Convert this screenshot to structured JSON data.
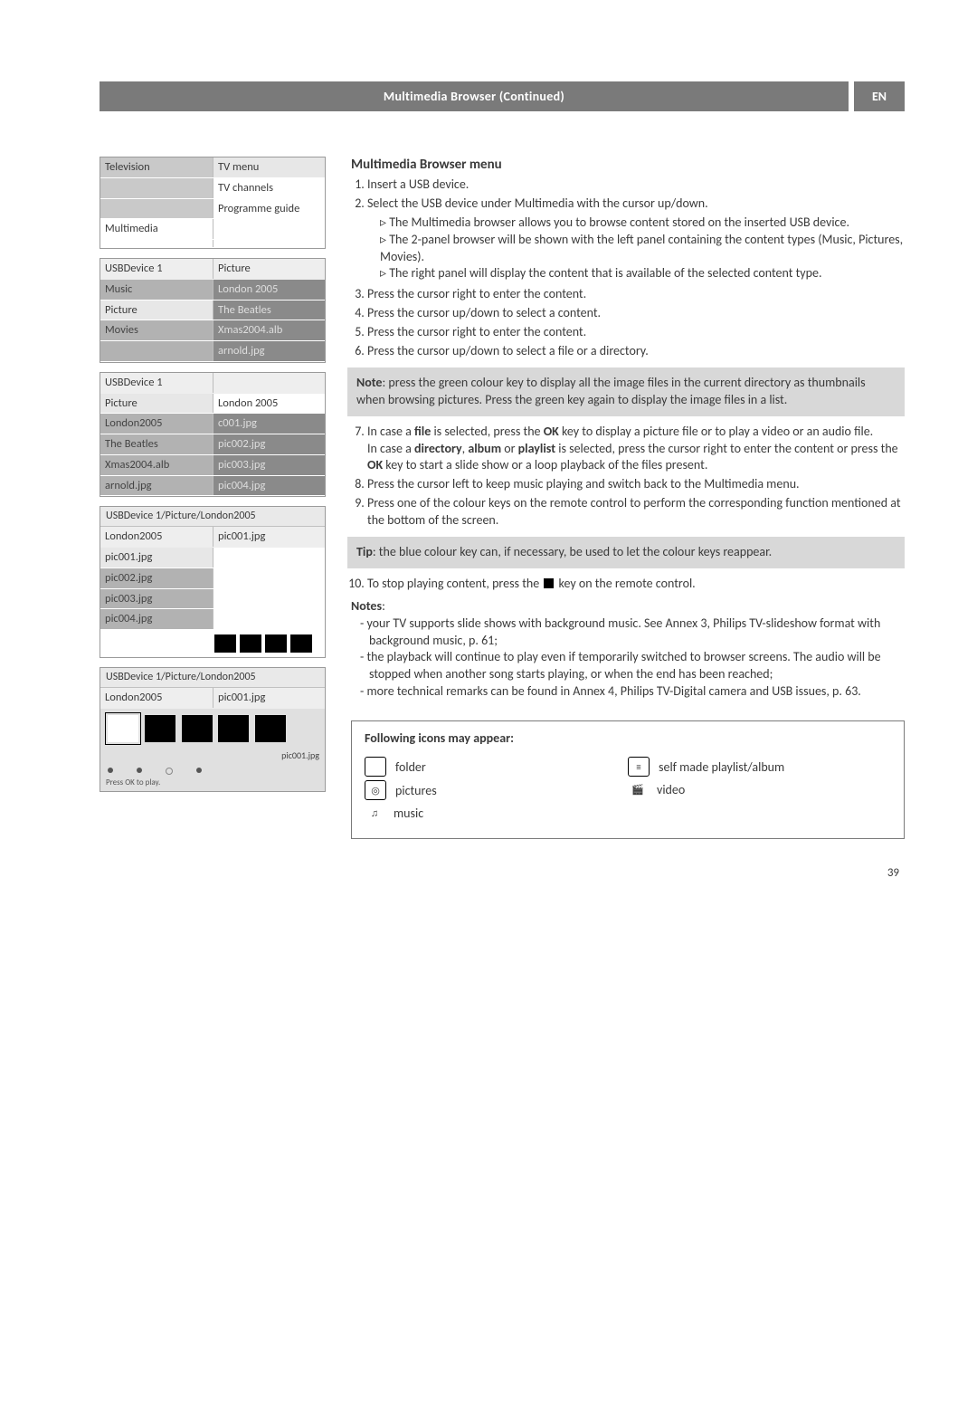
{
  "header": {
    "title": "Multimedia Browser  (Continued)",
    "lang": "EN"
  },
  "panel1": {
    "rows": [
      {
        "left": "Television",
        "right": "TV menu",
        "leftClass": "grey-bg",
        "rightClass": "ltgrey-bg"
      },
      {
        "left": "",
        "right": "TV channels",
        "leftClass": "grey-bg",
        "rightClass": "white-bg"
      },
      {
        "left": "",
        "right": "Programme guide",
        "leftClass": "grey-bg",
        "rightClass": "white-bg"
      },
      {
        "left": "Multimedia",
        "right": "",
        "leftClass": "white-bg",
        "rightClass": "white-bg"
      },
      {
        "left": "",
        "right": "",
        "leftClass": "white-bg",
        "rightClass": "white-bg"
      }
    ]
  },
  "panel2": {
    "header": {
      "left": "USBDevice 1",
      "right": "Picture"
    },
    "rows": [
      {
        "left": "Music",
        "right": "London 2005",
        "leftClass": "midgrey-bg",
        "rightClass": "darkgrey-bg faded"
      },
      {
        "left": "Picture",
        "right": "The Beatles",
        "leftClass": "ltgrey-bg",
        "rightClass": "darkgrey-bg faded"
      },
      {
        "left": "Movies",
        "right": "Xmas2004.alb",
        "leftClass": "midgrey-bg",
        "rightClass": "darkgrey-bg faded"
      },
      {
        "left": "",
        "right": "arnold.jpg",
        "leftClass": "midgrey-bg",
        "rightClass": "darkgrey-bg faded"
      }
    ]
  },
  "panel3": {
    "header": {
      "left": "USBDevice 1",
      "right": ""
    },
    "rows": [
      {
        "left": "Picture",
        "right": "London 2005",
        "leftClass": "ltgrey-bg",
        "rightClass": "white-bg"
      },
      {
        "left": "London2005",
        "right": "c001.jpg",
        "leftClass": "midgrey-bg",
        "rightClass": "darkgrey-bg faded"
      },
      {
        "left": "The Beatles",
        "right": "pic002.jpg",
        "leftClass": "midgrey-bg",
        "rightClass": "darkgrey-bg faded"
      },
      {
        "left": "Xmas2004.alb",
        "right": "pic003.jpg",
        "leftClass": "midgrey-bg",
        "rightClass": "darkgrey-bg faded"
      },
      {
        "left": "arnold.jpg",
        "right": "pic004.jpg",
        "leftClass": "midgrey-bg",
        "rightClass": "darkgrey-bg faded"
      }
    ]
  },
  "panel4": {
    "crumb": "USBDevice 1/Picture/London2005",
    "header": {
      "left": "London2005",
      "right": "pic001.jpg"
    },
    "rows": [
      {
        "left": "pic001.jpg",
        "leftClass": "ltgrey-bg"
      },
      {
        "left": "pic002.jpg",
        "leftClass": "midgrey-bg"
      },
      {
        "left": "pic003.jpg",
        "leftClass": "midgrey-bg"
      },
      {
        "left": "pic004.jpg",
        "leftClass": "midgrey-bg"
      }
    ]
  },
  "panel5": {
    "crumb": "USBDevice 1/Picture/London2005",
    "header": {
      "left": "London2005",
      "right": "pic001.jpg"
    },
    "thumb_label": "pic001.jpg",
    "pressok": "Press OK to play."
  },
  "section_title": "Multimedia Browser menu",
  "steps": [
    "Insert a USB device.",
    "Select the USB device under Multimedia with the cursor up/down.",
    "Press the cursor right to enter the content.",
    "Press the cursor up/down to select a content.",
    "Press the cursor right to enter the content.",
    "Press the cursor up/down to select a file or a directory."
  ],
  "sub_after_2": [
    "The Multimedia browser allows you to browse content stored on the inserted USB device.",
    "The 2-panel browser will be shown with the left panel containing the content types (Music, Pictures, Movies).",
    "The right panel will display the content that is available of the selected content type."
  ],
  "notebox": "Note: press the green colour key to display all the image files in the current directory as thumbnails when browsing pictures. Press the green key again to display the image files in a list.",
  "step7a": "In case a ",
  "step7b": "file",
  "step7c": " is selected, press the ",
  "step7d": "OK",
  "step7e": " key to display a picture file or to play a video or an audio file.",
  "step7f": "In case a ",
  "step7g": "directory",
  "step7h": ", ",
  "step7i": "album",
  "step7j": " or ",
  "step7k": "playlist",
  "step7l": " is selected, press the cursor right to enter the content or press the ",
  "step7m": "OK",
  "step7n": " key to start a slide show or a loop playback of the files present.",
  "step8": "Press the cursor left to keep music playing and switch back to the Multimedia menu.",
  "step9": "Press one of the colour keys on the remote control to perform the corresponding function mentioned at the bottom of the screen.",
  "tipbox": "Tip: the blue colour key can, if necessary, be used to let the colour keys reappear.",
  "step10a": "To stop playing content, press the ",
  "step10b": " key on the remote control.",
  "notes_label": "Notes",
  "notes": [
    "your TV supports slide shows with background music. See Annex 3, Philips TV-slideshow format with background music, p. 61;",
    "the playback will continue to play even if temporarily switched to browser screens. The audio will be stopped when another song starts playing, or when the end has been reached;",
    "more technical remarks can be found in Annex 4, Philips TV-Digital camera and USB issues, p. 63."
  ],
  "icons_title": "Following icons may appear:",
  "icons": {
    "folder": "folder",
    "pictures": "pictures",
    "music": "music",
    "playlist": "self made playlist/album",
    "video": "video"
  },
  "pagenum": "39"
}
